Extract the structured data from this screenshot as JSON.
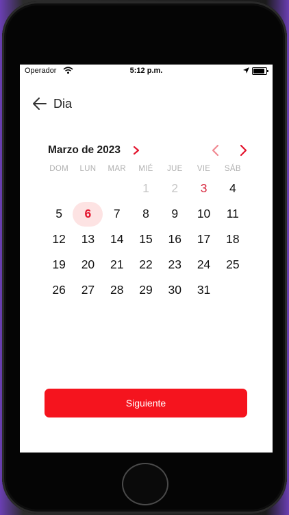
{
  "status_bar": {
    "carrier": "Operador",
    "time": "5:12 p.m."
  },
  "header": {
    "title": "Dia"
  },
  "calendar": {
    "month_label": "Marzo de 2023",
    "weekdays": [
      "DOM",
      "LUN",
      "MAR",
      "MIÉ",
      "JUE",
      "VIE",
      "SÁB"
    ],
    "days": [
      {
        "label": "",
        "state": "empty"
      },
      {
        "label": "",
        "state": "empty"
      },
      {
        "label": "",
        "state": "empty"
      },
      {
        "label": "1",
        "state": "muted"
      },
      {
        "label": "2",
        "state": "muted"
      },
      {
        "label": "3",
        "state": "red"
      },
      {
        "label": "4",
        "state": "normal"
      },
      {
        "label": "5",
        "state": "normal"
      },
      {
        "label": "6",
        "state": "selected"
      },
      {
        "label": "7",
        "state": "normal"
      },
      {
        "label": "8",
        "state": "normal"
      },
      {
        "label": "9",
        "state": "normal"
      },
      {
        "label": "10",
        "state": "normal"
      },
      {
        "label": "11",
        "state": "normal"
      },
      {
        "label": "12",
        "state": "normal"
      },
      {
        "label": "13",
        "state": "normal"
      },
      {
        "label": "14",
        "state": "normal"
      },
      {
        "label": "15",
        "state": "normal"
      },
      {
        "label": "16",
        "state": "normal"
      },
      {
        "label": "17",
        "state": "normal"
      },
      {
        "label": "18",
        "state": "normal"
      },
      {
        "label": "19",
        "state": "normal"
      },
      {
        "label": "20",
        "state": "normal"
      },
      {
        "label": "21",
        "state": "normal"
      },
      {
        "label": "22",
        "state": "normal"
      },
      {
        "label": "23",
        "state": "normal"
      },
      {
        "label": "24",
        "state": "normal"
      },
      {
        "label": "25",
        "state": "normal"
      },
      {
        "label": "26",
        "state": "normal"
      },
      {
        "label": "27",
        "state": "normal"
      },
      {
        "label": "28",
        "state": "normal"
      },
      {
        "label": "29",
        "state": "normal"
      },
      {
        "label": "30",
        "state": "normal"
      },
      {
        "label": "31",
        "state": "normal"
      }
    ]
  },
  "actions": {
    "next_label": "Siguiente"
  },
  "colors": {
    "accent": "#f5141e",
    "selected_bg": "#fde3e3",
    "weekday": "#b0b0b0"
  },
  "icons": {
    "back": "arrow-left-icon",
    "month_chevron": "chevron-right-icon",
    "prev": "chevron-left-icon",
    "next": "chevron-right-icon"
  }
}
